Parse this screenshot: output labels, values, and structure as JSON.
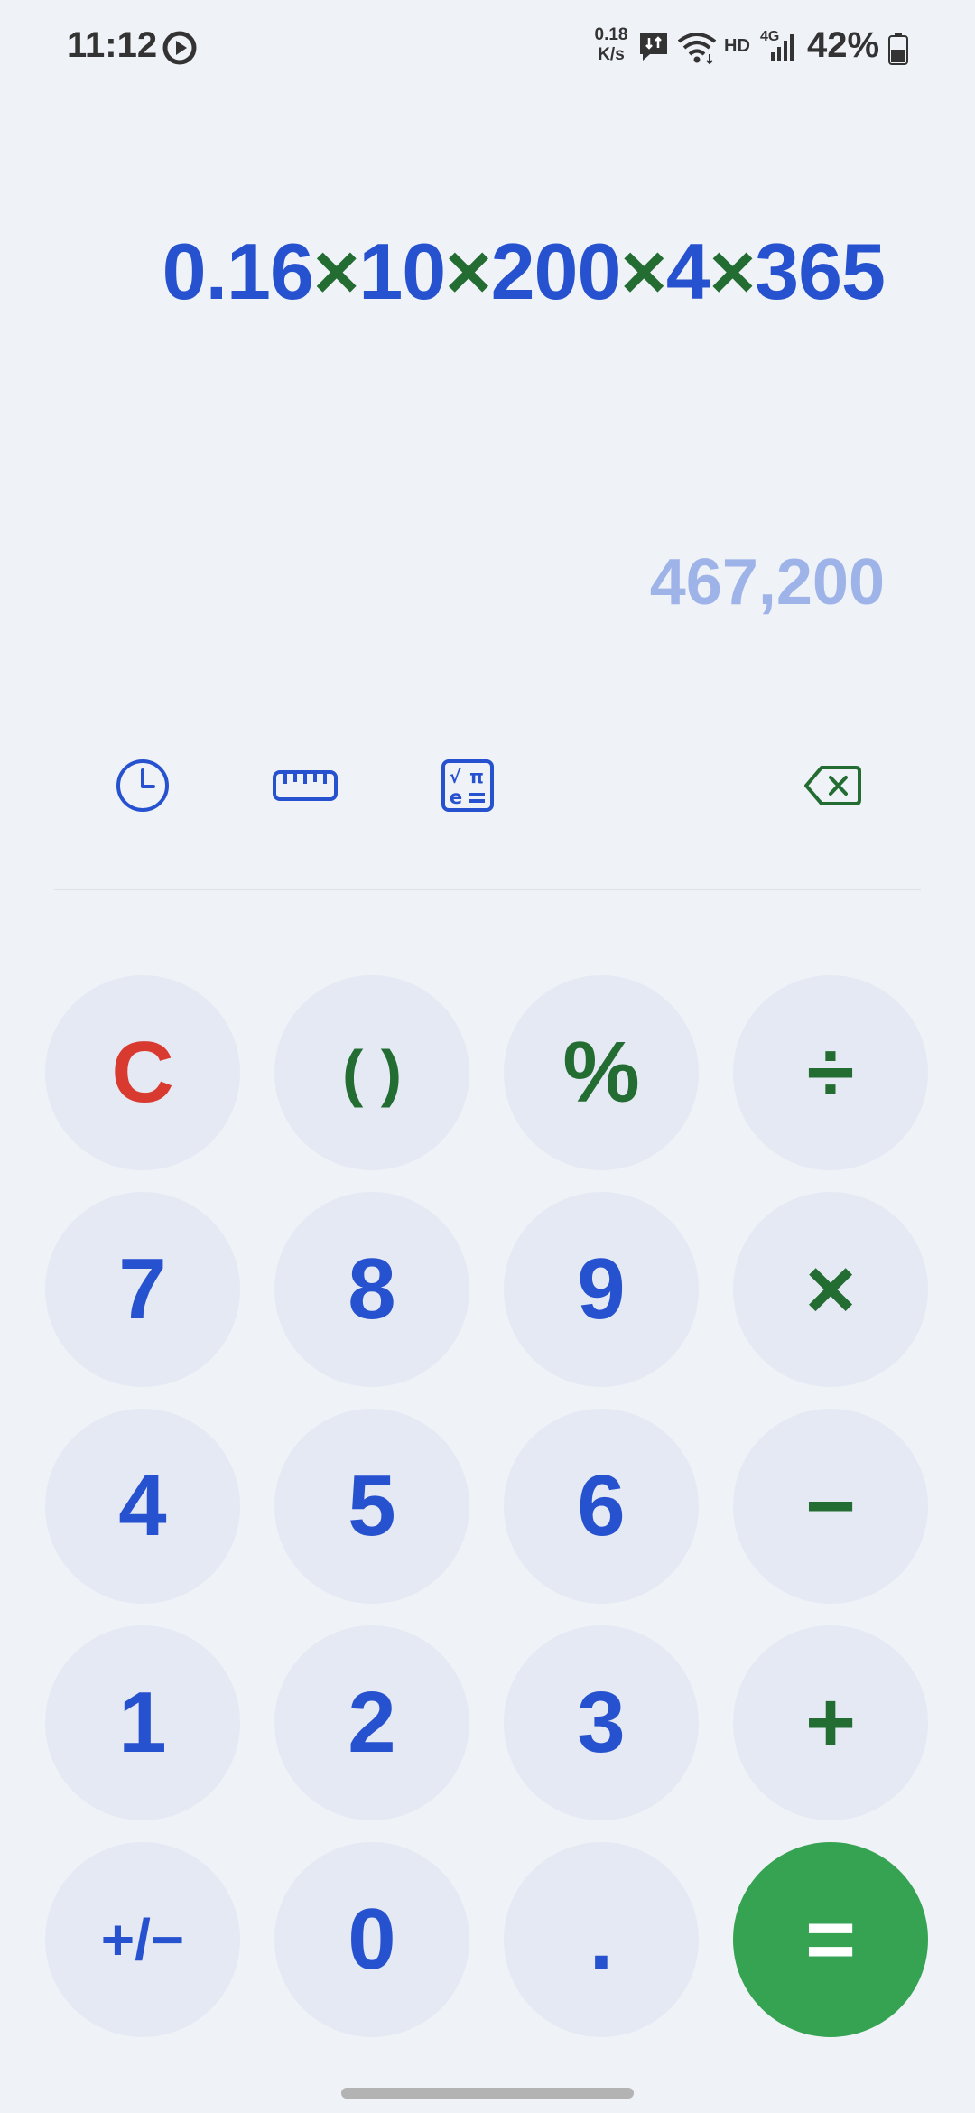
{
  "status_bar": {
    "time": "11:12",
    "net_speed_value": "0.18",
    "net_speed_unit": "K/s",
    "hd": "HD",
    "network": "4G",
    "battery": "42%"
  },
  "display": {
    "expression_parts": [
      {
        "t": "0.16",
        "kind": "num"
      },
      {
        "t": "×",
        "kind": "op"
      },
      {
        "t": "10",
        "kind": "num"
      },
      {
        "t": "×",
        "kind": "op"
      },
      {
        "t": "200",
        "kind": "num"
      },
      {
        "t": "×",
        "kind": "op"
      },
      {
        "t": "4",
        "kind": "num"
      },
      {
        "t": "×",
        "kind": "op"
      },
      {
        "t": "365",
        "kind": "num"
      }
    ],
    "result": "467,200"
  },
  "toolbar": {
    "history_icon": "clock-icon",
    "converter_icon": "ruler-icon",
    "scientific_icon": "scientific-calculator-icon",
    "backspace_icon": "backspace-icon"
  },
  "keys": {
    "clear": "C",
    "parentheses": "( )",
    "percent": "%",
    "divide": "÷",
    "seven": "7",
    "eight": "8",
    "nine": "9",
    "multiply": "×",
    "four": "4",
    "five": "5",
    "six": "6",
    "minus": "−",
    "one": "1",
    "two": "2",
    "three": "3",
    "plus": "+",
    "sign": "+/−",
    "zero": "0",
    "decimal": ".",
    "equals": "="
  },
  "colors": {
    "number_blue": "#2752cf",
    "operator_green": "#236d33",
    "clear_red": "#d93a2f",
    "equals_green": "#36a352",
    "result_light_blue": "#9eb3e8",
    "key_background": "#e5e9f3",
    "page_background": "#eff2f7"
  }
}
